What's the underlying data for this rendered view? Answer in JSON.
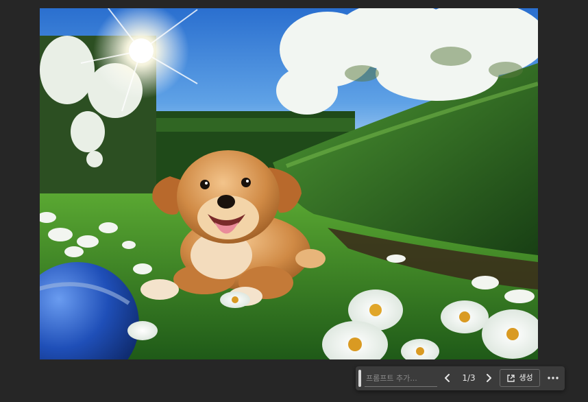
{
  "image": {
    "subject": "puppy-in-garden",
    "colors": {
      "sky": "#3f86d6",
      "grass": "#3d8a2a",
      "hedge": "#2f6a22",
      "puppy": "#d08a45",
      "ball": "#1f4fb8"
    }
  },
  "toolbar": {
    "prompt_placeholder": "프롬프트 추가...",
    "prompt_value": "",
    "page_counter": "1/3",
    "generate_label": "생성",
    "icons": {
      "prev": "chevron-left-icon",
      "next": "chevron-right-icon",
      "generate": "open-external-icon",
      "more": "more-horizontal-icon"
    }
  }
}
